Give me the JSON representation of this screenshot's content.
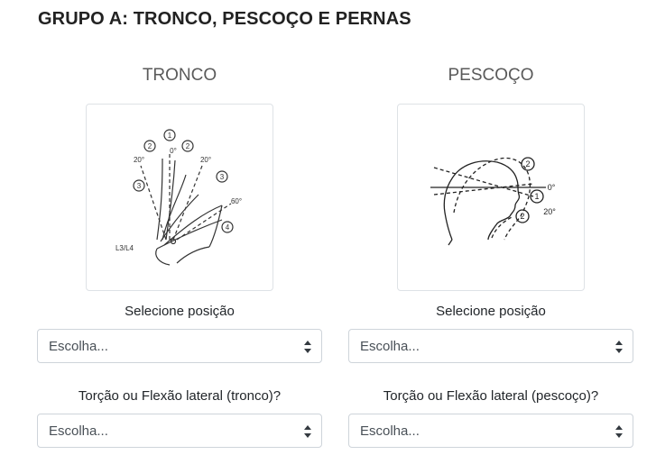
{
  "page": {
    "title": "GRUPO A: TRONCO, PESCOÇO E PERNAS"
  },
  "tronco": {
    "heading": "TRONCO",
    "figure_labels": {
      "c1": "1",
      "c2a": "2",
      "c2b": "2",
      "c3a": "3",
      "c3b": "3",
      "c4": "4",
      "deg0": "0°",
      "deg20a": "20°",
      "deg20b": "20°",
      "deg60": "60°",
      "spine": "L3/L4"
    },
    "position_label": "Selecione posição",
    "position_select_value": "Escolha...",
    "twist_label": "Torção ou Flexão lateral (tronco)?",
    "twist_select_value": "Escolha..."
  },
  "pescoco": {
    "heading": "PESCOÇO",
    "figure_labels": {
      "c2a": "2",
      "c1": "1",
      "c2b": "2",
      "deg0": "0°",
      "deg20": "20°"
    },
    "position_label": "Selecione posição",
    "position_select_value": "Escolha...",
    "twist_label": "Torção ou Flexão lateral (pescoço)?",
    "twist_select_value": "Escolha..."
  },
  "icons": {
    "select_arrow": "chevron-up-down-icon"
  }
}
